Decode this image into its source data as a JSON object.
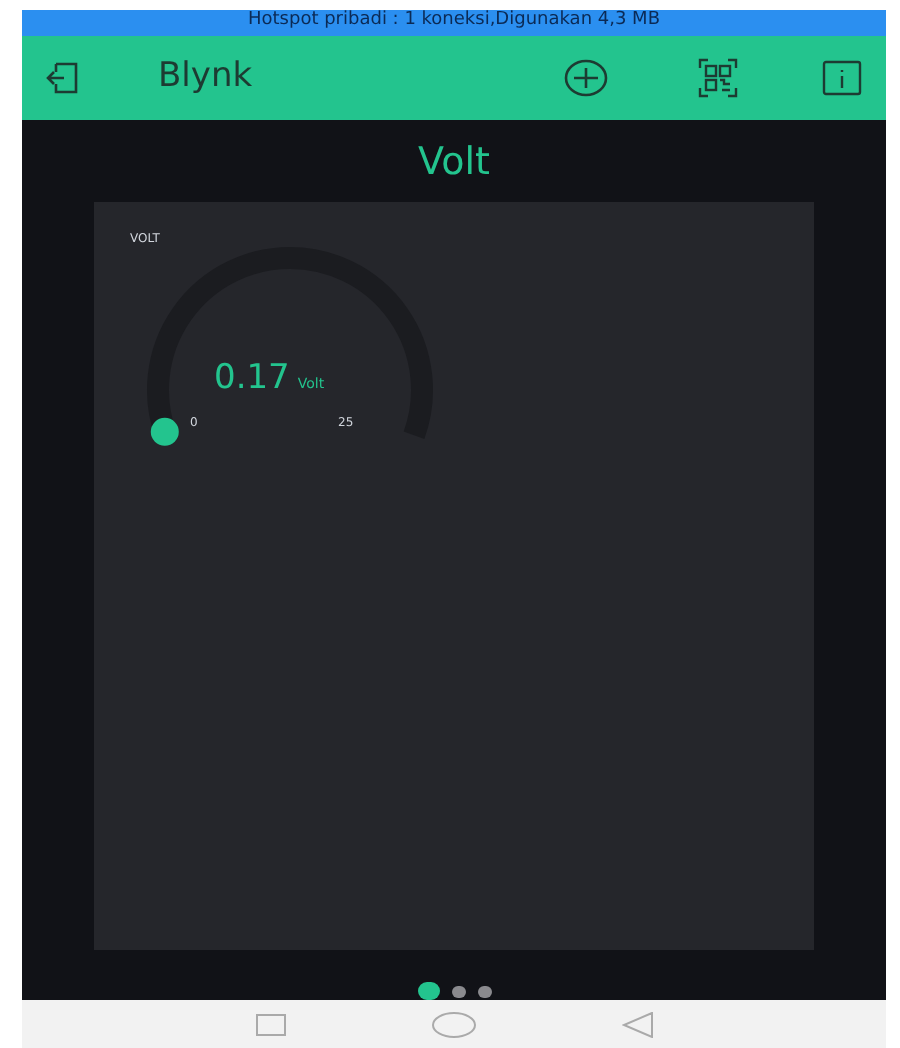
{
  "status_bar": {
    "text": "Hotspot pribadi : 1 koneksi,Digunakan 4,3 MB"
  },
  "app_bar": {
    "title": "Blynk"
  },
  "dashboard": {
    "title": "Volt",
    "widgets": [
      {
        "kind": "gauge",
        "label": "VOLT",
        "value": "0.17",
        "unit": "Volt",
        "min": "0",
        "max": "25",
        "level": 0.007
      }
    ]
  },
  "pages": [
    {
      "selected": true
    },
    {
      "selected": false
    },
    {
      "selected": false
    }
  ]
}
